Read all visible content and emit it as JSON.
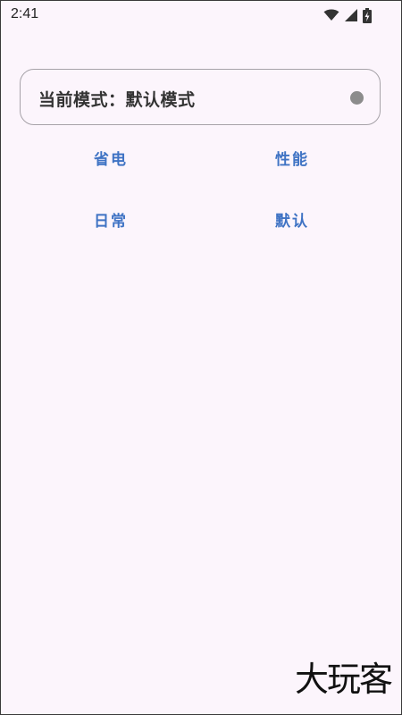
{
  "status_bar": {
    "time": "2:41",
    "icons": [
      "wifi-icon",
      "cellular-signal-icon",
      "battery-charging-icon"
    ]
  },
  "mode_card": {
    "label": "当前模式：默认模式",
    "indicator_icon": "status-dot-icon",
    "indicator_color": "#8c8c8c"
  },
  "modes": {
    "power_saving": "省电",
    "performance": "性能",
    "daily": "日常",
    "default": "默认"
  },
  "watermark": {
    "text": "大玩客"
  },
  "colors": {
    "background": "#fcf5fc",
    "accent": "#3f73c4",
    "card_border": "#a6a2a8"
  }
}
